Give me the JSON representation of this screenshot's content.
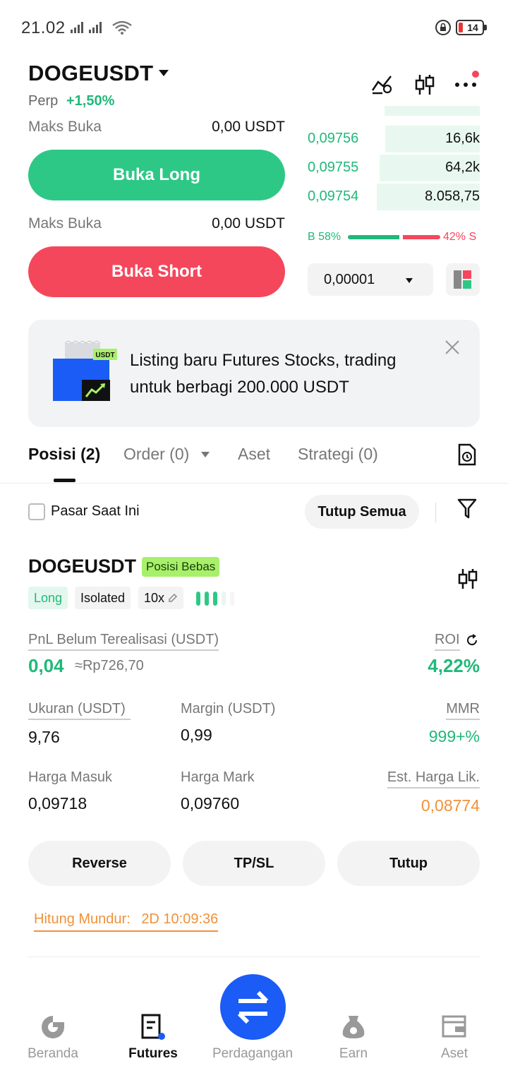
{
  "status": {
    "time": "21.02",
    "battery": "14"
  },
  "header": {
    "pair": "DOGEUSDT",
    "type": "Perp",
    "change": "+1,50%"
  },
  "order_panel": {
    "max_open_label_1": "Maks Buka",
    "max_open_value_1": "0,00 USDT",
    "open_long": "Buka Long",
    "max_open_label_2": "Maks Buka",
    "max_open_value_2": "0,00 USDT",
    "open_short": "Buka Short"
  },
  "orderbook": {
    "rows": [
      {
        "price": "0,09756",
        "qty": "16,6k",
        "depth": 0.55
      },
      {
        "price": "0,09755",
        "qty": "64,2k",
        "depth": 0.58
      },
      {
        "price": "0,09754",
        "qty": "8.058,75",
        "depth": 0.6
      }
    ],
    "buy_ratio": "B 58%",
    "sell_ratio": "42% S",
    "tick_size": "0,00001"
  },
  "banner": {
    "text": "Listing baru Futures Stocks, trading untuk berbagi 200.000 USDT",
    "badge": "USDT"
  },
  "tabs": [
    {
      "label": "Posisi (2)",
      "active": true
    },
    {
      "label": "Order (0)"
    },
    {
      "label": "Aset"
    },
    {
      "label": "Strategi (0)"
    }
  ],
  "filter": {
    "current_market": "Pasar Saat Ini",
    "close_all": "Tutup Semua"
  },
  "position": {
    "pair": "DOGEUSDT",
    "badge": "Posisi Bebas",
    "side": "Long",
    "margin_mode": "Isolated",
    "leverage": "10x",
    "pnl_label": "PnL Belum Terealisasi (USDT)",
    "pnl": "0,04",
    "pnl_idr": "≈Rp726,70",
    "roi_label": "ROI",
    "roi": "4,22%",
    "size_label": "Ukuran (USDT)",
    "size": "9,76",
    "margin_label": "Margin (USDT)",
    "margin": "0,99",
    "mmr_label": "MMR",
    "mmr": "999+%",
    "entry_label": "Harga Masuk",
    "entry": "0,09718",
    "mark_label": "Harga Mark",
    "mark": "0,09760",
    "liq_label": "Est. Harga Lik.",
    "liq": "0,08774",
    "actions": {
      "reverse": "Reverse",
      "tpsl": "TP/SL",
      "close": "Tutup"
    },
    "countdown_label": "Hitung Mundur:",
    "countdown": "2D 10:09:36"
  },
  "nav": [
    {
      "label": "Beranda"
    },
    {
      "label": "Futures",
      "active": true
    },
    {
      "label": "Perdagangan"
    },
    {
      "label": "Earn"
    },
    {
      "label": "Aset"
    }
  ],
  "colors": {
    "green": "#2ec886",
    "red": "#f5475c",
    "blue": "#1a5cf5",
    "orange": "#f0913a"
  }
}
